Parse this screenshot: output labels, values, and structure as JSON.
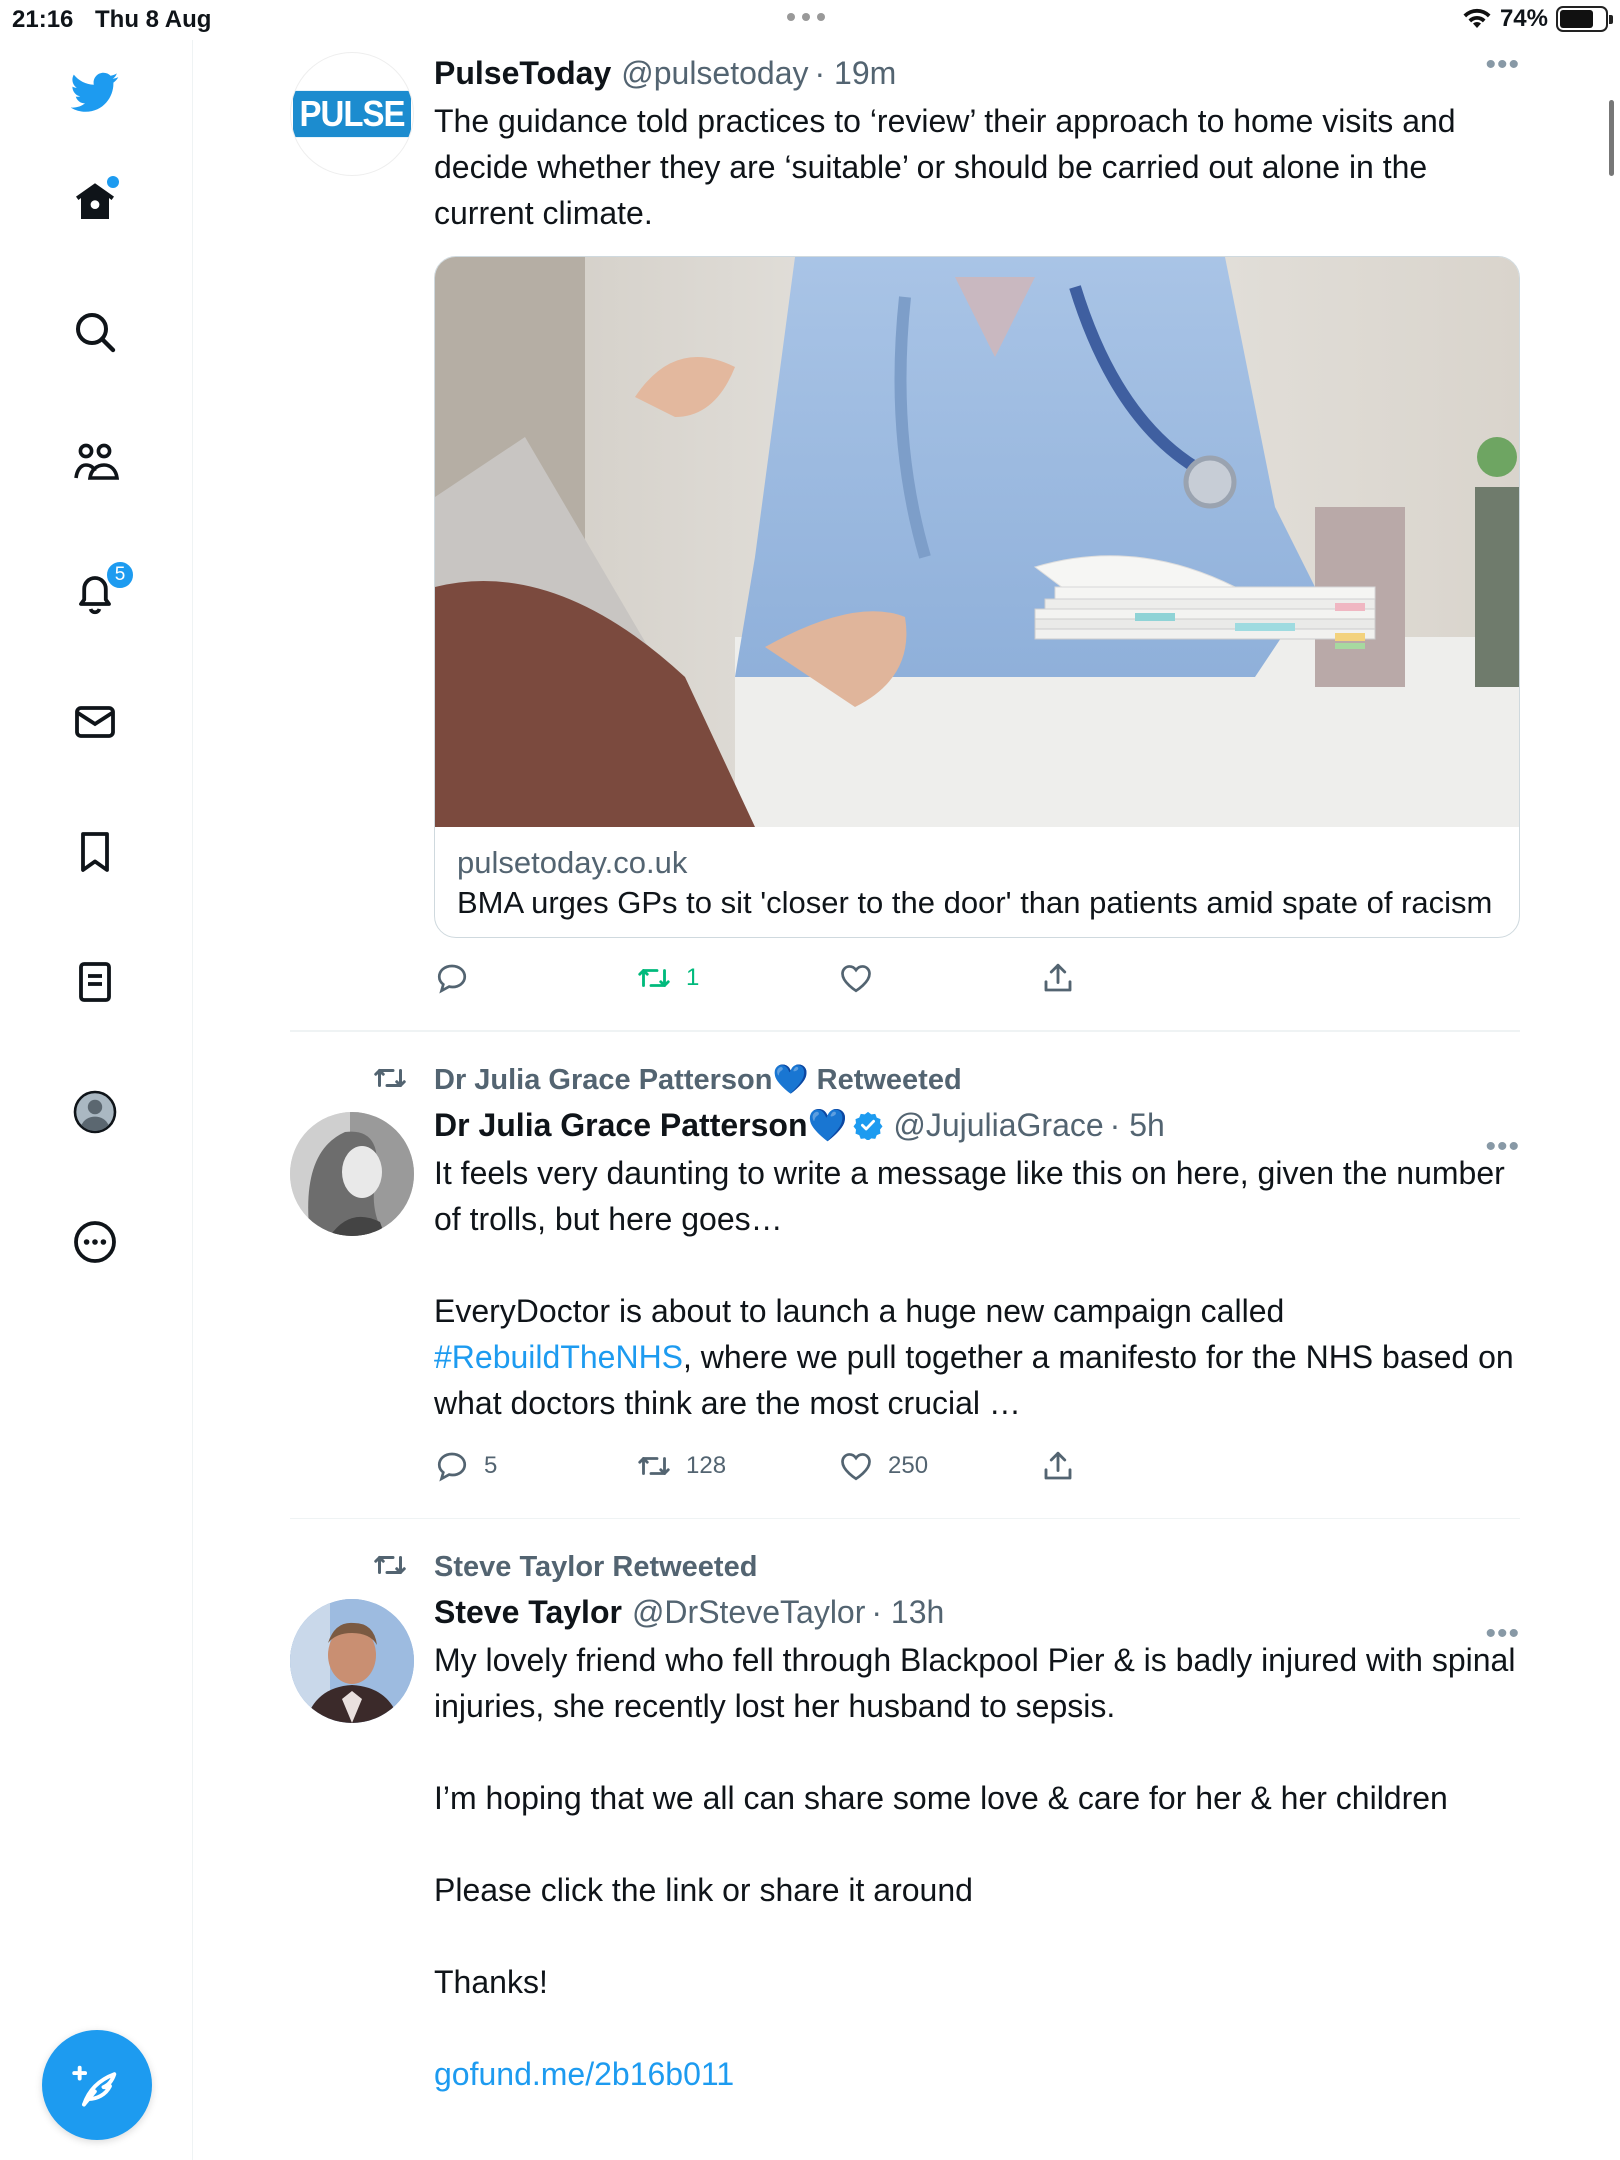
{
  "status_bar": {
    "time": "21:16",
    "date": "Thu 8 Aug",
    "battery": "74%",
    "battery_level": 0.74
  },
  "sidebar": {
    "notifications_badge": "5"
  },
  "tweets": [
    {
      "name": "PulseToday",
      "handle": "@pulsetoday",
      "time": "· 19m",
      "avatar_text": "PULSE",
      "text": "The guidance told practices to ‘review’ their approach to home visits and decide whether they are ‘suitable’ or should be carried out alone in the current climate.",
      "card": {
        "domain": "pulsetoday.co.uk",
        "title": "BMA urges GPs to sit 'closer to the door' than patients amid spate of racism"
      },
      "replies": "",
      "retweets": "1",
      "likes": ""
    },
    {
      "retweeted_by": "Dr Julia Grace Patterson💙 Retweeted",
      "name": "Dr Julia Grace Patterson💙",
      "handle": "@JujuliaGrace",
      "time": "· 5h",
      "text_before": "It feels very daunting to write a message like this on here, given the number of trolls, but here goes…\n\nEveryDoctor is about to launch a huge new campaign called ",
      "hashtag": "#RebuildTheNHS",
      "text_after": ", where we pull together a manifesto for the NHS based on what doctors think are the most crucial …",
      "replies": "5",
      "retweets": "128",
      "likes": "250"
    },
    {
      "retweeted_by": "Steve Taylor Retweeted",
      "name": "Steve Taylor",
      "handle": "@DrSteveTaylor",
      "time": "· 13h",
      "text": "My lovely friend who fell through Blackpool Pier & is badly injured with spinal injuries, she recently lost her husband to sepsis.\n\nI’m hoping that we all can share some love & care for her & her children\n\nPlease click the link or share it around\n\nThanks!",
      "link": "gofund.me/2b16b011"
    }
  ],
  "colors": {
    "accent": "#1d9bf0",
    "retweet_green": "#00ba7c",
    "secondary_text": "#536471"
  }
}
